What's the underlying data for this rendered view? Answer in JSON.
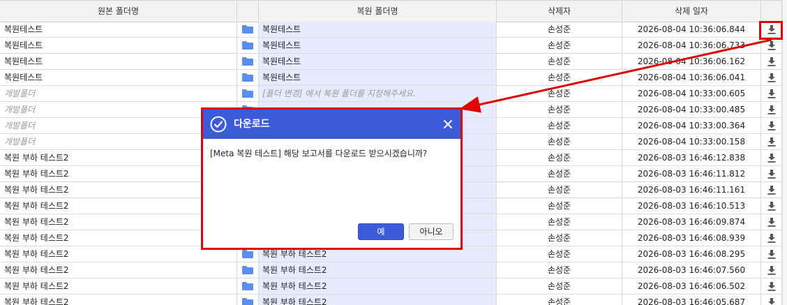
{
  "table": {
    "headers": [
      "원본 폴더명",
      "복원 폴더명",
      "삭제자",
      "삭제 일자"
    ],
    "rows": [
      {
        "orig": "복원테스트",
        "orig_placeholder": false,
        "restore": "복원테스트",
        "restore_placeholder": false,
        "user": "손성준",
        "date": "2026-08-04 10:36:06.844"
      },
      {
        "orig": "복원테스트",
        "orig_placeholder": false,
        "restore": "복원테스트",
        "restore_placeholder": false,
        "user": "손성준",
        "date": "2026-08-04 10:36:06.733"
      },
      {
        "orig": "복원테스트",
        "orig_placeholder": false,
        "restore": "복원테스트",
        "restore_placeholder": false,
        "user": "손성준",
        "date": "2026-08-04 10:36:06.162"
      },
      {
        "orig": "복원테스트",
        "orig_placeholder": false,
        "restore": "복원테스트",
        "restore_placeholder": false,
        "user": "손성준",
        "date": "2026-08-04 10:36:06.041"
      },
      {
        "orig": "개발폴더",
        "orig_placeholder": true,
        "restore": "[폴더 변경] 에서 복원 폴더를 지정해주세요.",
        "restore_placeholder": true,
        "user": "손성준",
        "date": "2026-08-04 10:33:00.605"
      },
      {
        "orig": "개발폴더",
        "orig_placeholder": true,
        "restore": "",
        "restore_placeholder": true,
        "user": "손성준",
        "date": "2026-08-04 10:33:00.485"
      },
      {
        "orig": "개발폴더",
        "orig_placeholder": true,
        "restore": "",
        "restore_placeholder": true,
        "user": "손성준",
        "date": "2026-08-04 10:33:00.364"
      },
      {
        "orig": "개발폴더",
        "orig_placeholder": true,
        "restore": "",
        "restore_placeholder": true,
        "user": "손성준",
        "date": "2026-08-04 10:33:00.158"
      },
      {
        "orig": "복원 부하 테스트2",
        "orig_placeholder": false,
        "restore": "",
        "restore_placeholder": false,
        "user": "손성준",
        "date": "2026-08-03 16:46:12.838"
      },
      {
        "orig": "복원 부하 테스트2",
        "orig_placeholder": false,
        "restore": "",
        "restore_placeholder": false,
        "user": "손성준",
        "date": "2026-08-03 16:46:11.812"
      },
      {
        "orig": "복원 부하 테스트2",
        "orig_placeholder": false,
        "restore": "",
        "restore_placeholder": false,
        "user": "손성준",
        "date": "2026-08-03 16:46:11.161"
      },
      {
        "orig": "복원 부하 테스트2",
        "orig_placeholder": false,
        "restore": "",
        "restore_placeholder": false,
        "user": "손성준",
        "date": "2026-08-03 16:46:10.513"
      },
      {
        "orig": "복원 부하 테스트2",
        "orig_placeholder": false,
        "restore": "",
        "restore_placeholder": false,
        "user": "손성준",
        "date": "2026-08-03 16:46:09.874"
      },
      {
        "orig": "복원 부하 테스트2",
        "orig_placeholder": false,
        "restore": "",
        "restore_placeholder": false,
        "user": "손성준",
        "date": "2026-08-03 16:46:08.939"
      },
      {
        "orig": "복원 부하 테스트2",
        "orig_placeholder": false,
        "restore": "복원 부하 테스트2",
        "restore_placeholder": false,
        "user": "손성준",
        "date": "2026-08-03 16:46:08.295"
      },
      {
        "orig": "복원 부하 테스트2",
        "orig_placeholder": false,
        "restore": "복원 부하 테스트2",
        "restore_placeholder": false,
        "user": "손성준",
        "date": "2026-08-03 16:46:07.560"
      },
      {
        "orig": "복원 부하 테스트2",
        "orig_placeholder": false,
        "restore": "복원 부하 테스트2",
        "restore_placeholder": false,
        "user": "손성준",
        "date": "2026-08-03 16:46:06.502"
      },
      {
        "orig": "복원 부하 테스트2",
        "orig_placeholder": false,
        "restore": "복원 부하 테스트2",
        "restore_placeholder": false,
        "user": "손성준",
        "date": "2026-08-03 16:46:05.687"
      }
    ]
  },
  "dialog": {
    "title": "다운로드",
    "message": "[Meta 복원 테스트] 해당 보고서를 다운로드 받으시겠습니까?",
    "yes_label": "예",
    "no_label": "아니오"
  },
  "icons": {
    "folder": "folder-icon",
    "download": "download-icon",
    "check": "check-circle-icon",
    "close": "close-icon"
  },
  "colors": {
    "accent": "#3b5bdb",
    "highlight": "#e00000",
    "folder": "#5b8def",
    "restore_bg": "#e8ebfd"
  }
}
